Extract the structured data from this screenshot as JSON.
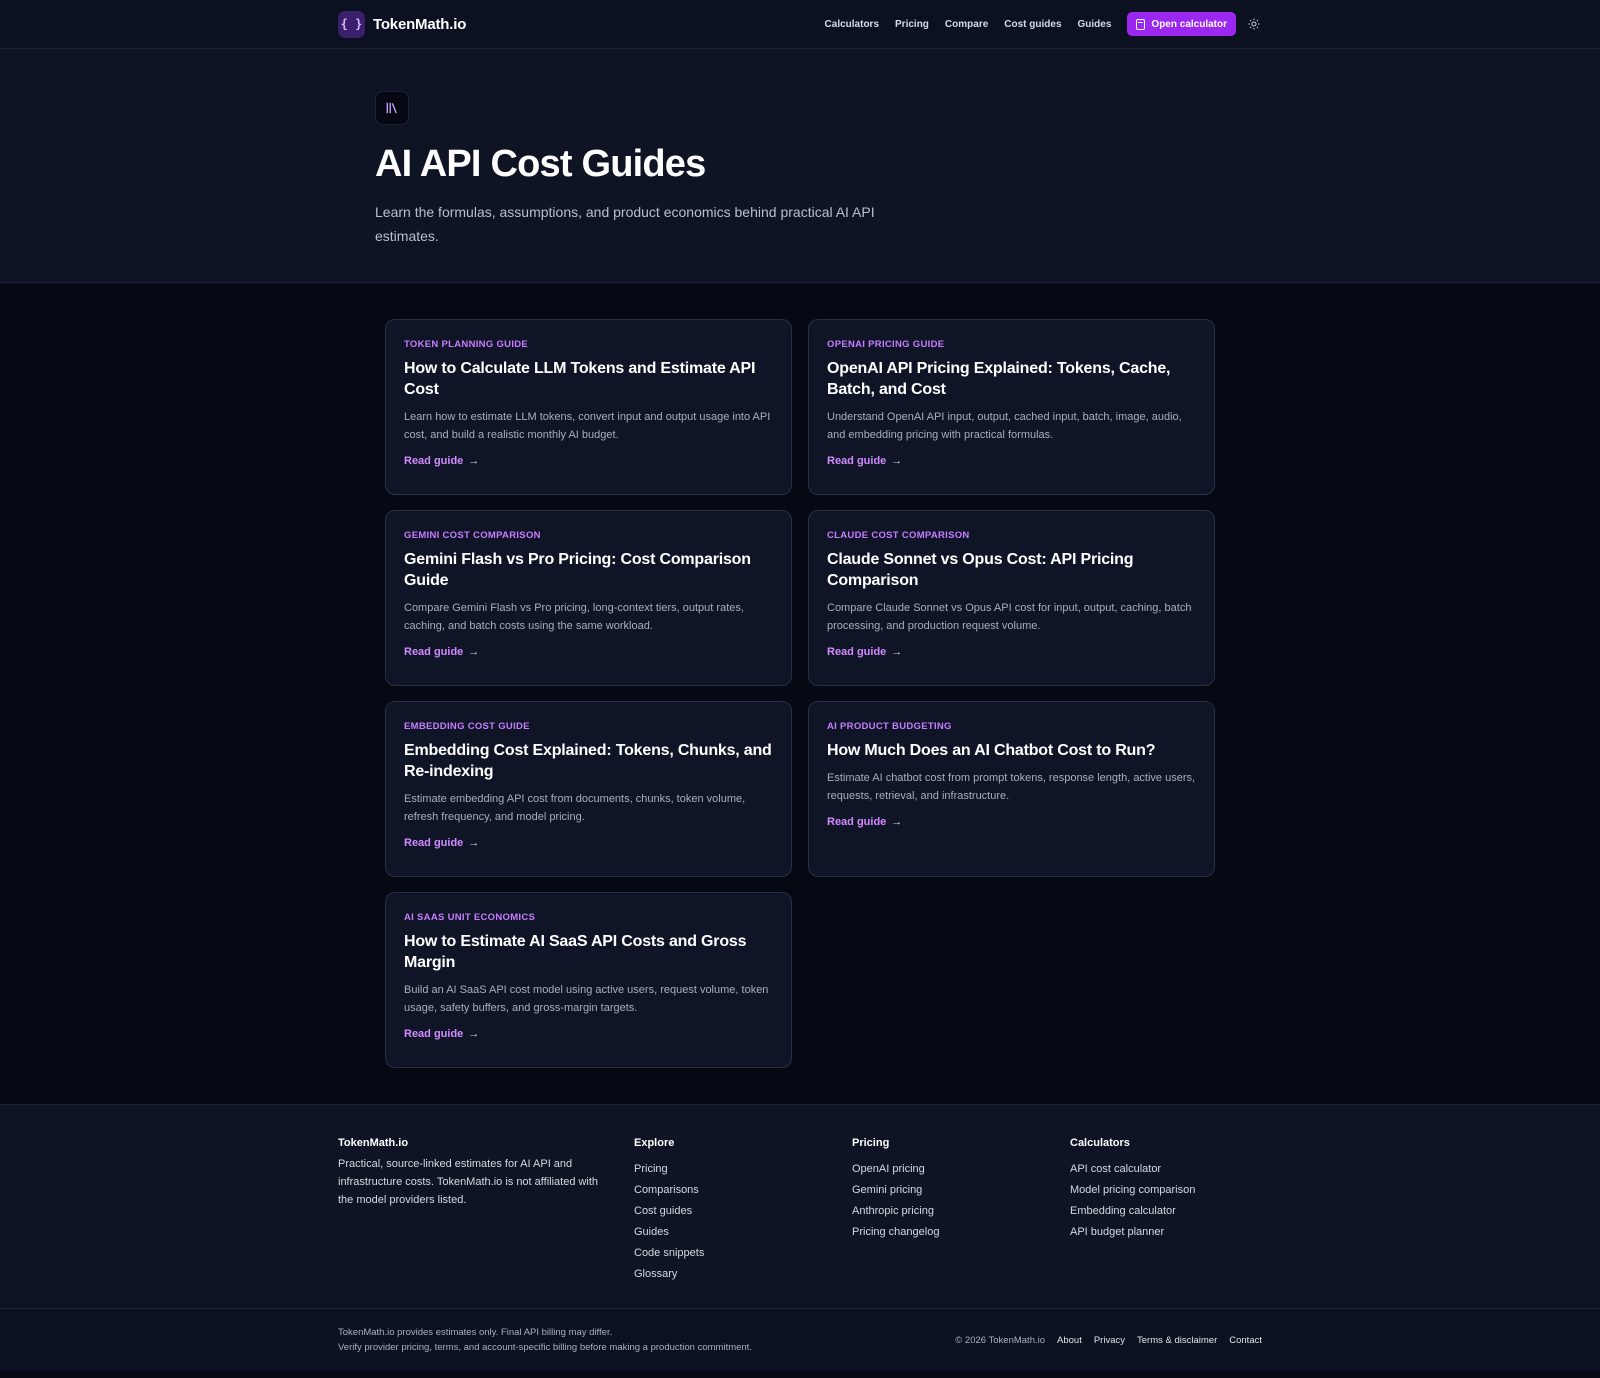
{
  "nav": {
    "logo_glyph": "{ }",
    "brand": "TokenMath.io",
    "links": [
      "Calculators",
      "Pricing",
      "Compare",
      "Cost guides",
      "Guides"
    ],
    "cta_label": "Open calculator",
    "theme_icon": "sun-icon"
  },
  "hero": {
    "icon": "library-icon",
    "title": "AI API Cost Guides",
    "subtitle": "Learn the formulas, assumptions, and product economics behind practical AI API estimates."
  },
  "cards": [
    {
      "tag": "TOKEN PLANNING GUIDE",
      "title": "How to Calculate LLM Tokens and Estimate API Cost",
      "desc": "Learn how to estimate LLM tokens, convert input and output usage into API cost, and build a realistic monthly AI budget.",
      "link": "Read guide"
    },
    {
      "tag": "OPENAI PRICING GUIDE",
      "title": "OpenAI API Pricing Explained: Tokens, Cache, Batch, and Cost",
      "desc": "Understand OpenAI API input, output, cached input, batch, image, audio, and embedding pricing with practical formulas.",
      "link": "Read guide"
    },
    {
      "tag": "GEMINI COST COMPARISON",
      "title": "Gemini Flash vs Pro Pricing: Cost Comparison Guide",
      "desc": "Compare Gemini Flash vs Pro pricing, long-context tiers, output rates, caching, and batch costs using the same workload.",
      "link": "Read guide"
    },
    {
      "tag": "CLAUDE COST COMPARISON",
      "title": "Claude Sonnet vs Opus Cost: API Pricing Comparison",
      "desc": "Compare Claude Sonnet vs Opus API cost for input, output, caching, batch processing, and production request volume.",
      "link": "Read guide"
    },
    {
      "tag": "EMBEDDING COST GUIDE",
      "title": "Embedding Cost Explained: Tokens, Chunks, and Re-indexing",
      "desc": "Estimate embedding API cost from documents, chunks, token volume, refresh frequency, and model pricing.",
      "link": "Read guide"
    },
    {
      "tag": "AI PRODUCT BUDGETING",
      "title": "How Much Does an AI Chatbot Cost to Run?",
      "desc": "Estimate AI chatbot cost from prompt tokens, response length, active users, requests, retrieval, and infrastructure.",
      "link": "Read guide"
    },
    {
      "tag": "AI SAAS UNIT ECONOMICS",
      "title": "How to Estimate AI SaaS API Costs and Gross Margin",
      "desc": "Build an AI SaaS API cost model using active users, request volume, token usage, safety buffers, and gross-margin targets.",
      "link": "Read guide"
    }
  ],
  "footer": {
    "brand": "TokenMath.io",
    "about": "Practical, source-linked estimates for AI API and infrastructure costs. TokenMath.io is not affiliated with the model providers listed.",
    "columns": [
      {
        "title": "Explore",
        "items": [
          "Pricing",
          "Comparisons",
          "Cost guides",
          "Guides",
          "Code snippets",
          "Glossary"
        ]
      },
      {
        "title": "Pricing",
        "items": [
          "OpenAI pricing",
          "Gemini pricing",
          "Anthropic pricing",
          "Pricing changelog"
        ]
      },
      {
        "title": "Calculators",
        "items": [
          "API cost calculator",
          "Model pricing comparison",
          "Embedding calculator",
          "API budget planner"
        ]
      }
    ]
  },
  "bottom": {
    "disclaimer_1": "TokenMath.io provides estimates only. Final API billing may differ.",
    "disclaimer_2": "Verify provider pricing, terms, and account-specific billing before making a production commitment.",
    "copyright": "© 2026 TokenMath.io",
    "links": [
      "About",
      "Privacy",
      "Terms & disclaimer",
      "Contact"
    ]
  },
  "colors": {
    "accent": "#9b27f0",
    "tag": "#c77dff",
    "link": "#d38bff",
    "background": "#060914",
    "panel": "#0e1424",
    "card": "#0f1526"
  }
}
